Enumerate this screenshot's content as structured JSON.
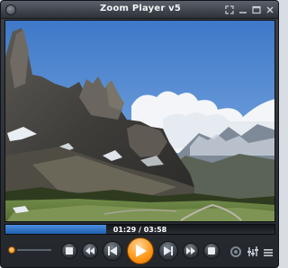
{
  "window": {
    "title": "Zoom Player v5",
    "buttons": {
      "fullscreen_icon": "expand-icon",
      "minimize_icon": "minimize-icon",
      "maximize_icon": "maximize-icon",
      "close_icon": "close-icon"
    }
  },
  "video": {
    "scene": "mountain-landscape"
  },
  "playback": {
    "time_display": "01:29 / 03:58",
    "progress_fraction": 0.374
  },
  "controls": {
    "volume_fraction": 0.0,
    "buttons": [
      "stop-icon",
      "rewind-icon",
      "previous-icon",
      "play-icon",
      "next-icon",
      "fast-forward-icon",
      "record-icon",
      "settings-icon",
      "equalizer-icon",
      "menu-icon"
    ]
  },
  "colors": {
    "accent": "#ff9a1a",
    "progress": "#3a7fd4"
  }
}
